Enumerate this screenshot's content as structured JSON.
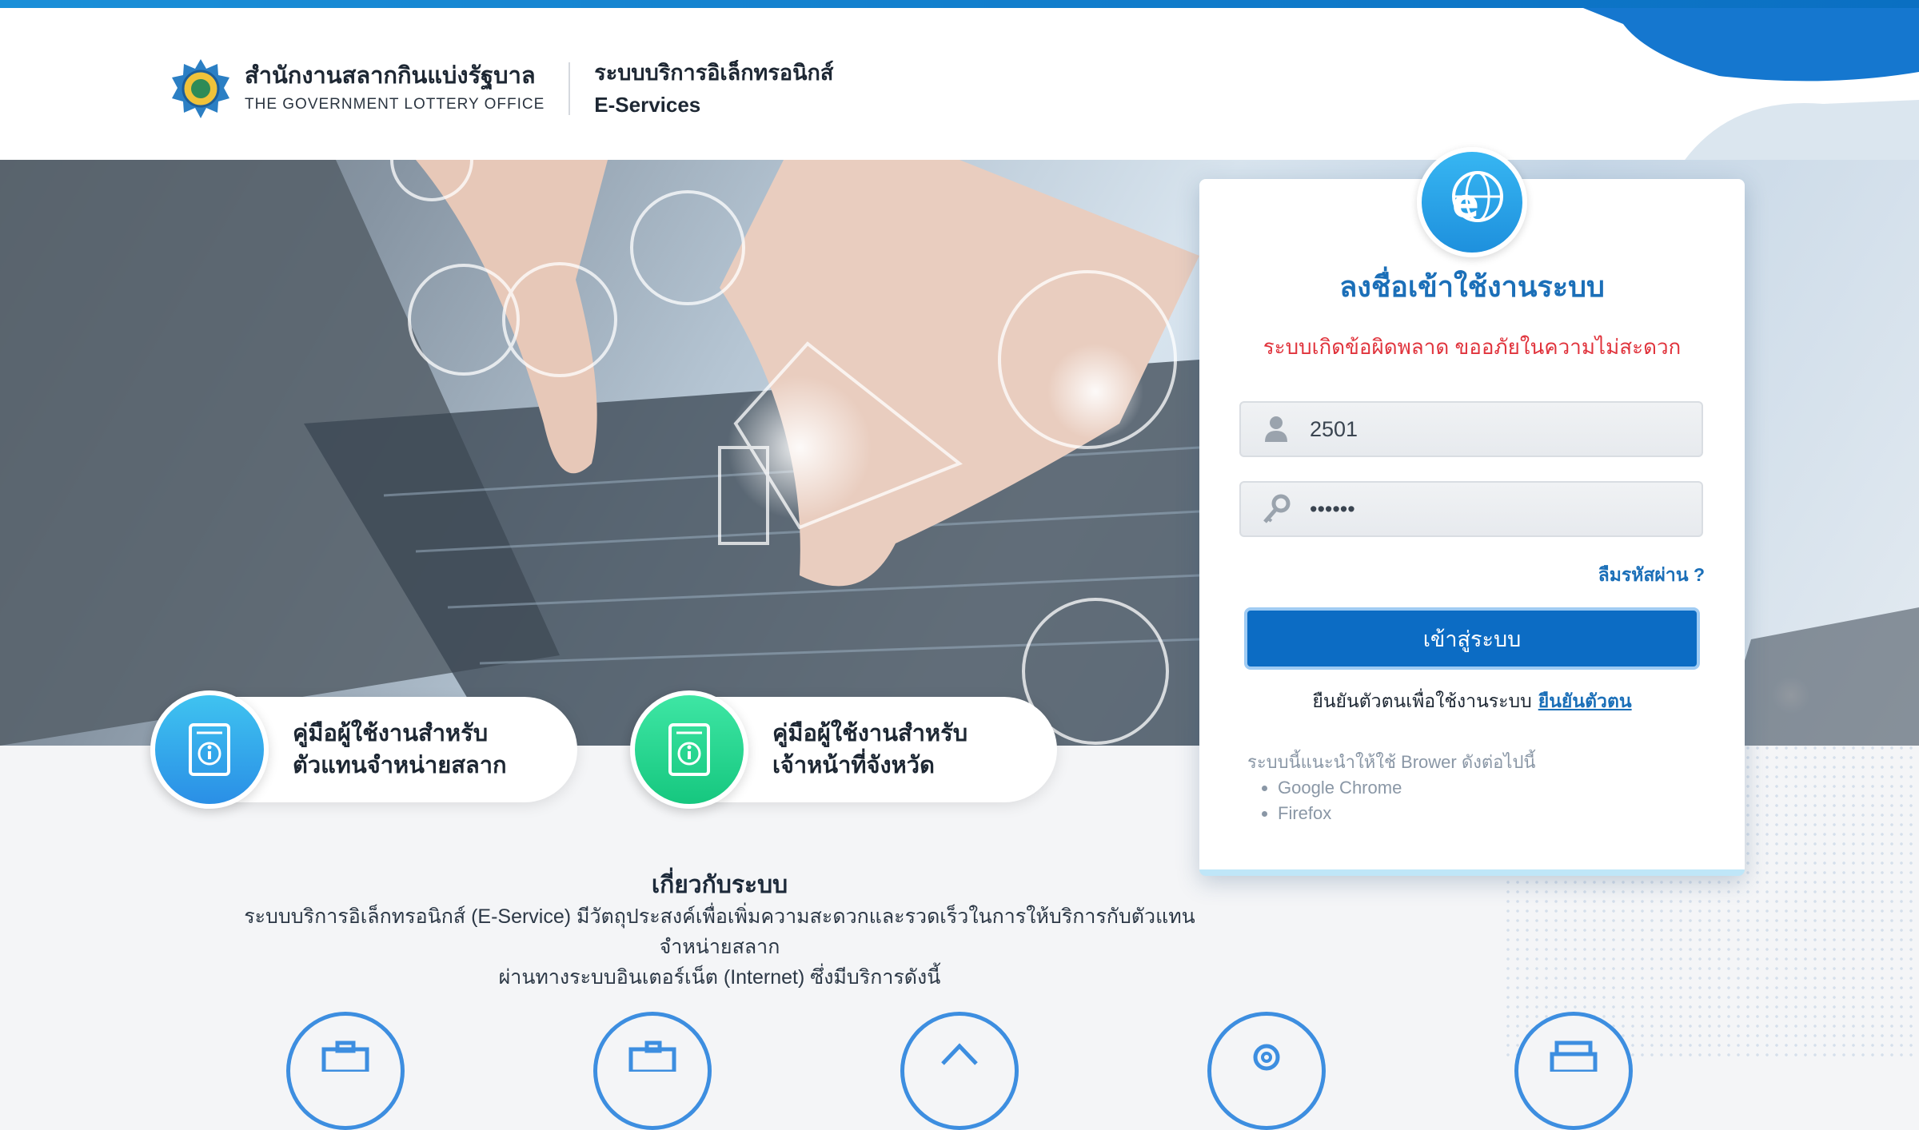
{
  "header": {
    "org_name_th": "สำนักงานสลากกินแบ่งรัฐบาล",
    "org_name_en": "THE GOVERNMENT LOTTERY OFFICE",
    "service_name_th": "ระบบบริการอิเล็กทรอนิกส์",
    "service_name_en": "E-Services"
  },
  "guides": [
    {
      "line1": "คู่มือผู้ใช้งานสำหรับ",
      "line2": "ตัวแทนจำหน่ายสลาก",
      "icon": "info-document-icon",
      "color": "#2a9fea"
    },
    {
      "line1": "คู่มือผู้ใช้งานสำหรับ",
      "line2": "เจ้าหน้าที่จังหวัด",
      "icon": "info-document-icon",
      "color": "#1dd08a"
    }
  ],
  "about": {
    "title": "เกี่ยวกับระบบ",
    "line1": "ระบบบริการอิเล็กทรอนิกส์ (E-Service) มีวัตถุประสงค์เพื่อเพิ่มความสะดวกและรวดเร็วในการให้บริการกับตัวแทนจำหน่ายสลาก",
    "line2": "ผ่านทางระบบอินเตอร์เน็ต (Internet) ซึ่งมีบริการดังนี้"
  },
  "login": {
    "title": "ลงชื่อเข้าใช้งานระบบ",
    "error": "ระบบเกิดข้อผิดพลาด ขออภัยในความไม่สะดวก",
    "username_value": "2501",
    "password_value": "••••••",
    "forgot_label": "ลืมรหัสผ่าน ?",
    "submit_label": "เข้าสู่ระบบ",
    "verify_text": "ยืนยันตัวตนเพื่อใช้งานระบบ",
    "verify_link": "ยืนยันตัวตน",
    "browser_note": "ระบบนี้แนะนำให้ใช้ Brower ดังต่อไปนี้",
    "browsers": [
      "Google Chrome",
      "Firefox"
    ]
  },
  "colors": {
    "accent": "#0c6cc4",
    "title_blue": "#1b6fb8",
    "error_red": "#e0333c"
  }
}
